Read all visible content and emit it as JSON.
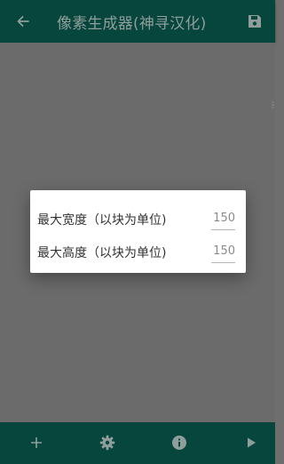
{
  "app": {
    "title": "像素生成器(神寻汉化)",
    "back_icon": "arrow-back-icon",
    "save_icon": "save-icon"
  },
  "dialog": {
    "max_width_label": "最大宽度（以块为单位)",
    "max_width_value": "150",
    "max_height_label": "最大高度（以块为单位)",
    "max_height_value": "150"
  },
  "bottom_bar": {
    "icons": [
      "add-icon",
      "settings-gear-icon",
      "info-icon",
      "play-icon"
    ]
  },
  "colors": {
    "app_bar": "#06463c",
    "scrim_content": "#6b6b6b",
    "dialog_bg": "#ffffff",
    "icon_dim": "#8f9e9b"
  }
}
